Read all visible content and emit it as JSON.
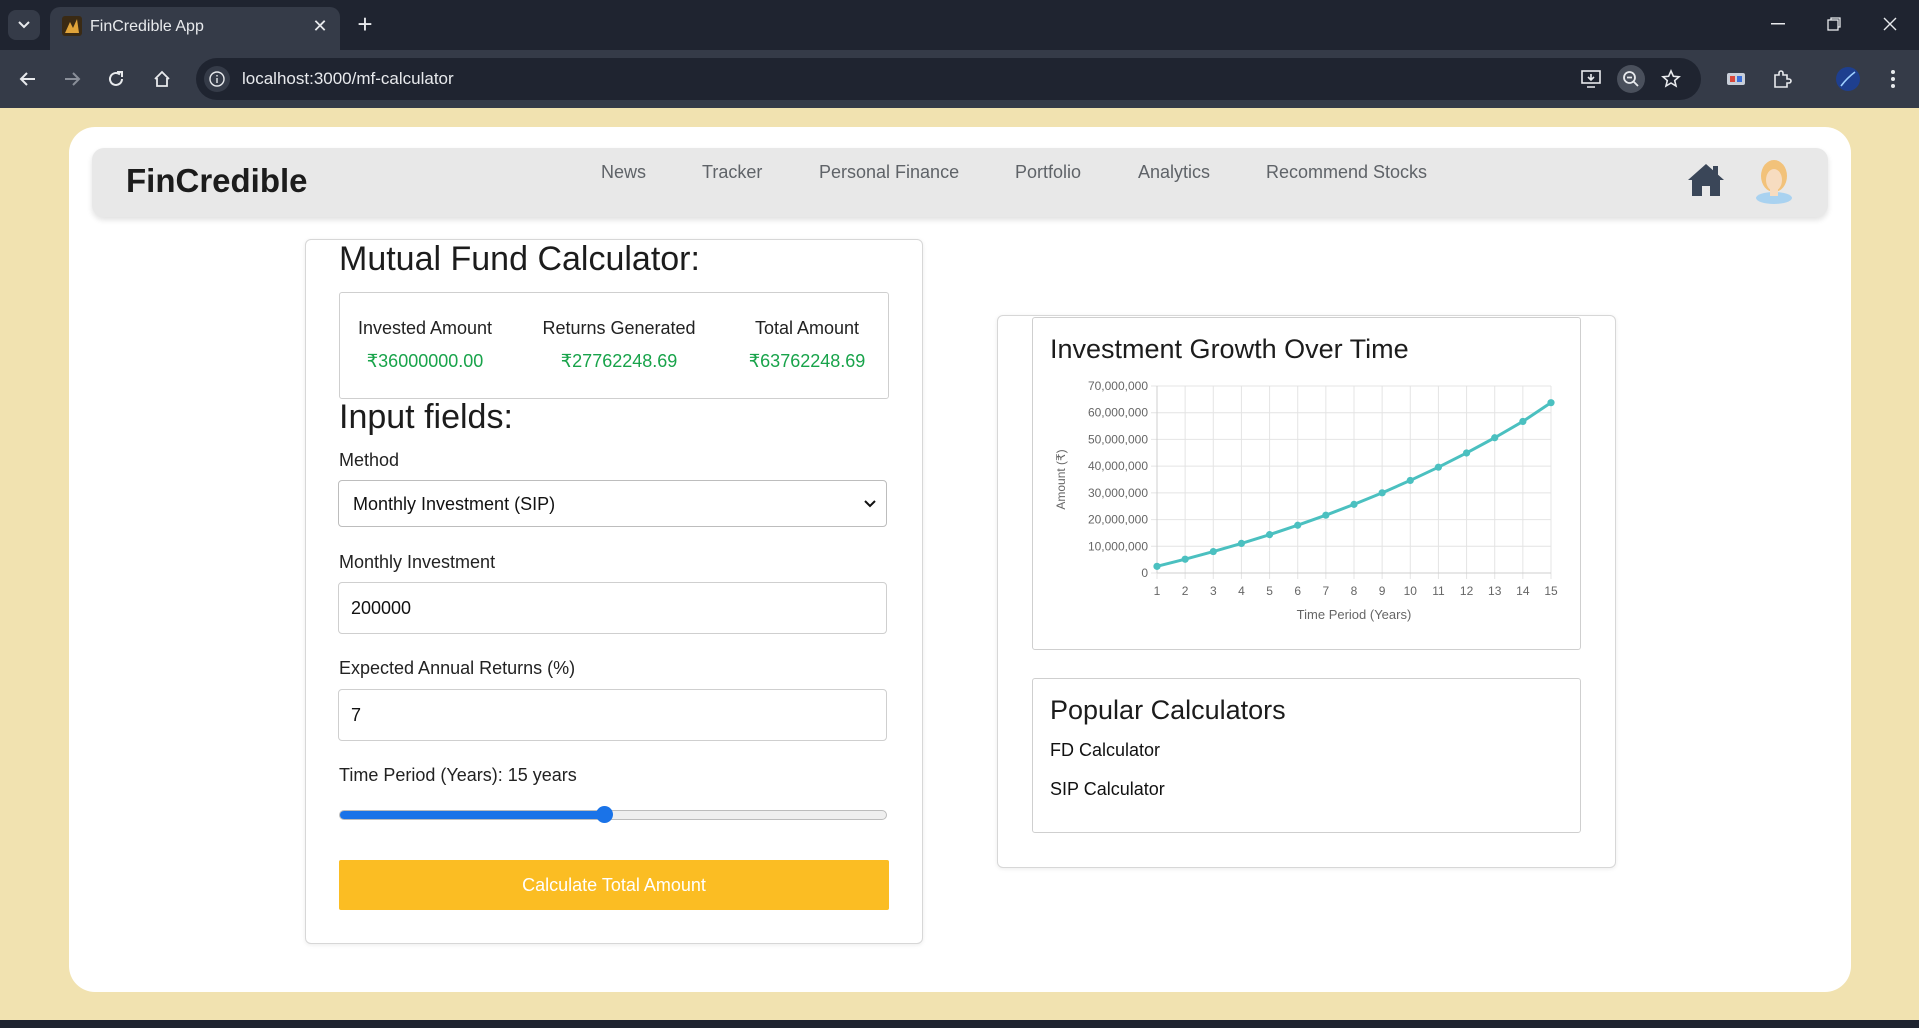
{
  "browser": {
    "tab_title": "FinCredible App",
    "url": "localhost:3000/mf-calculator"
  },
  "nav": {
    "brand": "FinCredible",
    "links": [
      "News",
      "Tracker",
      "Personal Finance",
      "Portfolio",
      "Analytics",
      "Recommend Stocks"
    ]
  },
  "calculator": {
    "title": "Mutual Fund Calculator:",
    "summary": {
      "invested_label": "Invested Amount",
      "invested_value": "₹36000000.00",
      "returns_label": "Returns Generated",
      "returns_value": "₹27762248.69",
      "total_label": "Total Amount",
      "total_value": "₹63762248.69"
    },
    "inputs_title": "Input fields:",
    "method_label": "Method",
    "method_value": "Monthly Investment (SIP)",
    "monthly_label": "Monthly Investment",
    "monthly_value": "200000",
    "returns_rate_label": "Expected Annual Returns (%)",
    "returns_rate_value": "7",
    "period_label": "Time Period (Years): 15 years",
    "period_slider_fraction": 0.483,
    "button_label": "Calculate Total Amount"
  },
  "popular": {
    "title": "Popular Calculators",
    "items": [
      "FD Calculator",
      "SIP Calculator"
    ]
  },
  "colors": {
    "accent_line": "#4bc0c0",
    "button": "#fbbd23",
    "value_green": "#18a34a",
    "slider": "#1a73e8"
  },
  "chart_data": {
    "type": "line",
    "title": "Investment Growth Over Time",
    "xlabel": "Time Period (Years)",
    "ylabel": "Amount (₹)",
    "x": [
      1,
      2,
      3,
      4,
      5,
      6,
      7,
      8,
      9,
      10,
      11,
      12,
      13,
      14,
      15
    ],
    "y_tick_labels": [
      "0",
      "10,000,000",
      "20,000,000",
      "30,000,000",
      "40,000,000",
      "50,000,000",
      "60,000,000",
      "70,000,000"
    ],
    "ylim": [
      0,
      70000000
    ],
    "grid": true,
    "series": [
      {
        "values": [
          2490000,
          5160000,
          8020000,
          11080000,
          14360000,
          17880000,
          21650000,
          25690000,
          30010000,
          34650000,
          39610000,
          44930000,
          50630000,
          56730000,
          63760000
        ]
      }
    ]
  }
}
